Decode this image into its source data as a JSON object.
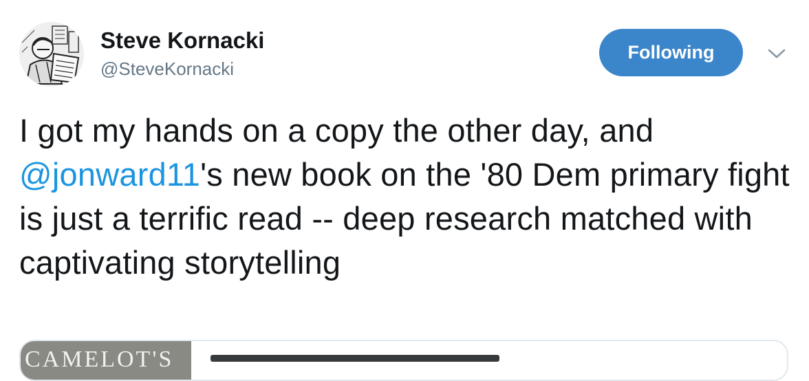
{
  "user": {
    "display_name": "Steve Kornacki",
    "handle": "@SteveKornacki"
  },
  "follow_button": {
    "label": "Following",
    "color": "#3b86cb"
  },
  "menu": {
    "icon": "chevron-down-icon"
  },
  "tweet": {
    "text_before": "I got my hands on a copy the other day, and ",
    "mention": "@jonward11",
    "text_after": "'s new book on the '80 Dem primary fight is just a terrific read -- deep research matched with captivating storytelling",
    "mention_color": "#1b95e0"
  },
  "card": {
    "image_title": "CAMELOT'S"
  }
}
